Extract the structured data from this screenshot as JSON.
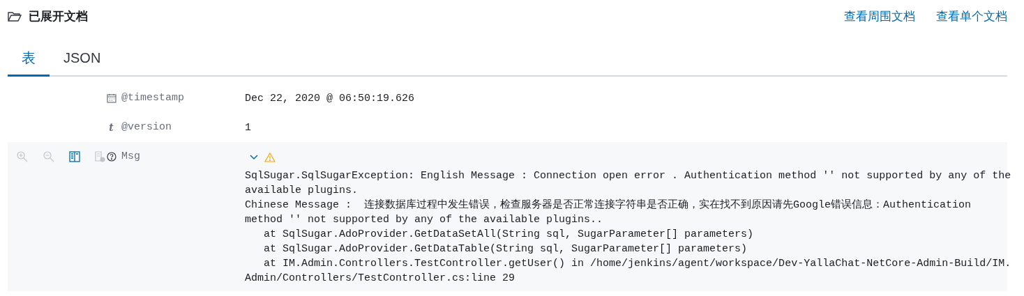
{
  "header": {
    "title": "已展开文档",
    "links": [
      "查看周围文档",
      "查看单个文档"
    ]
  },
  "tabs": [
    {
      "label": "表",
      "selected": true
    },
    {
      "label": "JSON",
      "selected": false
    }
  ],
  "fields": [
    {
      "kind": "date",
      "name": "@timestamp",
      "highlighted": false,
      "lines": [
        "Dec 22, 2020 @ 06:50:19.626"
      ]
    },
    {
      "kind": "string",
      "type_glyph": "t",
      "name": "@version",
      "highlighted": false,
      "lines": [
        "1"
      ]
    },
    {
      "kind": "unknown",
      "name": "Msg",
      "highlighted": true,
      "expanded": true,
      "warning": true,
      "lines": [
        "SqlSugar.SqlSugarException: English Message : Connection open error . Authentication method '' not supported by any of the",
        "available plugins.",
        "Chinese Message :  连接数据库过程中发生错误，检查服务器是否正常连接字符串是否正确，实在找不到原因请先Google错误信息：Authentication",
        "method '' not supported by any of the available plugins..",
        "   at SqlSugar.AdoProvider.GetDataSetAll(String sql, SugarParameter[] parameters)",
        "   at SqlSugar.AdoProvider.GetDataTable(String sql, SugarParameter[] parameters)",
        "   at IM.Admin.Controllers.TestController.getUser() in /home/jenkins/agent/workspace/Dev-YallaChat-NetCore-Admin-Build/IM.",
        "Admin/Controllers/TestController.cs:line 29"
      ]
    }
  ]
}
